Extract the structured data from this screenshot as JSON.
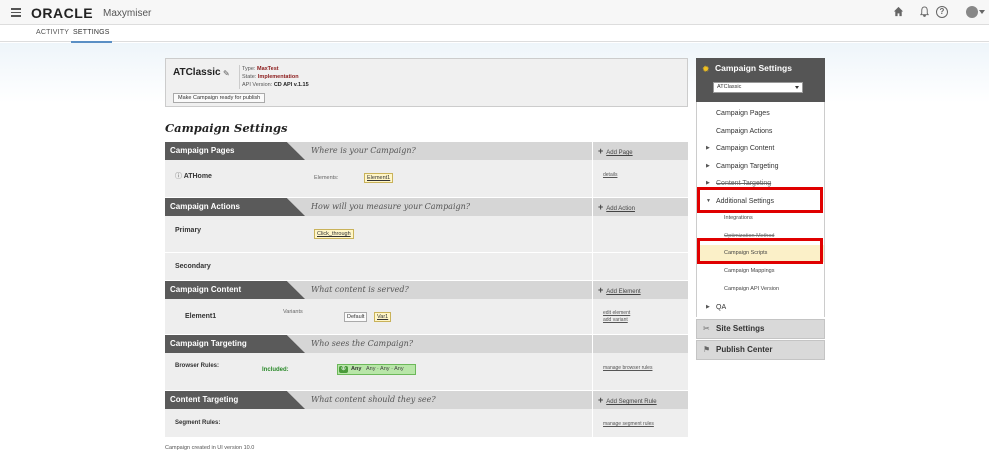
{
  "topbar": {
    "logo": "ORACLE",
    "product": "Maxymiser",
    "icons": [
      "menu-icon",
      "home-icon",
      "bell-icon",
      "help-icon",
      "avatar"
    ],
    "help_glyph": "?"
  },
  "subnav": {
    "tabs": [
      "ACTIVITY",
      "SETTINGS"
    ],
    "active": "SETTINGS"
  },
  "campaign": {
    "name": "ATClassic",
    "type_label": "Type:",
    "type_value": "MaxTest",
    "state_label": "State:",
    "state_value": "Implementation",
    "api_label": "API Version:",
    "api_value": "CD API v.1.15",
    "ready_button": "Make Campaign ready for publish"
  },
  "page_heading": "Campaign Settings",
  "sections": {
    "pages": {
      "title": "Campaign Pages",
      "question": "Where is your Campaign?",
      "add": "Add Page",
      "row": {
        "name": "ATHome",
        "elements_label": "Elements:",
        "element": "Element1",
        "link": "details"
      }
    },
    "actions": {
      "title": "Campaign Actions",
      "question": "How will you measure your Campaign?",
      "add": "Add Action",
      "primary": "Primary",
      "primary_action": "Click_through",
      "secondary": "Secondary"
    },
    "content": {
      "title": "Campaign Content",
      "question": "What content is served?",
      "add": "Add Element",
      "row": {
        "name": "Element1",
        "variants_label": "Variants",
        "default": "Default",
        "var": "Var1",
        "link1": "edit element",
        "link2": "add variant"
      }
    },
    "targeting": {
      "title": "Campaign Targeting",
      "question": "Who sees the Campaign?",
      "row": {
        "name": "Browser Rules:",
        "included": "Included:",
        "any": "Any",
        "any_rest": "Any · Any · Any",
        "link": "manage browser rules"
      }
    },
    "content_targeting": {
      "title": "Content Targeting",
      "question": "What content should they see?",
      "add": "Add Segment Rule",
      "row": {
        "name": "Segment Rules:",
        "link": "manage segment rules"
      }
    }
  },
  "footnote": "Campaign created in UI version 10.0",
  "right_panel": {
    "title": "Campaign Settings",
    "select_value": "ATClassic",
    "items": {
      "pages": "Campaign Pages",
      "actions": "Campaign Actions",
      "content": "Campaign Content",
      "targeting": "Campaign Targeting",
      "content_targeting": "Content Targeting",
      "additional": "Additional Settings",
      "integrations": "Integrations",
      "optimization": "Optimization Method",
      "scripts": "Campaign Scripts",
      "mappings": "Campaign Mappings",
      "api_version": "Campaign API Version",
      "qa": "QA"
    },
    "site_settings": "Site Settings",
    "publish_center": "Publish Center"
  },
  "colors": {
    "highlight": "#e00000",
    "section_title_bg": "#5a5a5a",
    "chip_yellow": "#fff6c8",
    "included_green": "#2a8a2a"
  }
}
